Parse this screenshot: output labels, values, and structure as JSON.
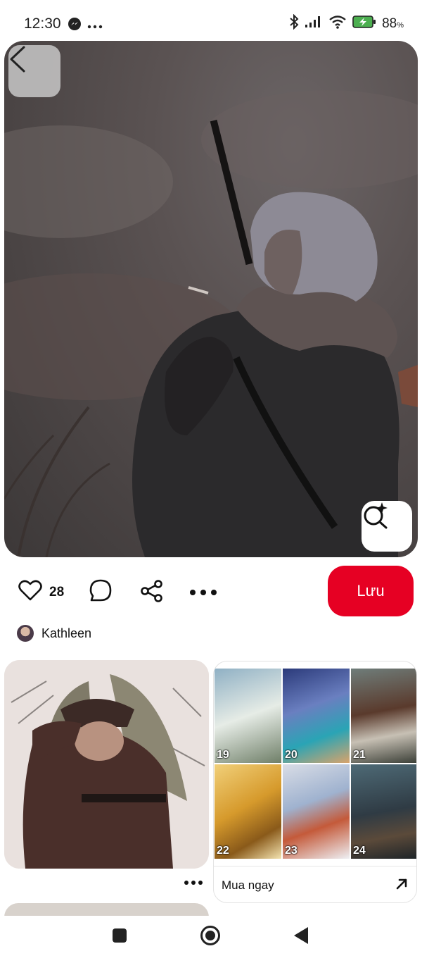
{
  "status_bar": {
    "time": "12:30",
    "battery": "88",
    "battery_unit": "%",
    "icons": [
      "messenger-icon",
      "more-dots-icon",
      "bluetooth-icon",
      "signal-icon",
      "wifi-icon",
      "battery-charging-icon"
    ]
  },
  "pin": {
    "back_icon": "chevron-left-icon",
    "visual_search_icon": "lens-sparkle-icon",
    "like_count": "28",
    "save_label": "Lưu",
    "author_name": "Kathleen"
  },
  "related": {
    "right_card": {
      "tile_numbers": [
        "19",
        "20",
        "21",
        "22",
        "23",
        "24"
      ],
      "buy_label": "Mua ngay",
      "buy_icon": "arrow-up-right-icon"
    }
  },
  "colors": {
    "save_button": "#e60023",
    "hero_tone": "#4a4444"
  }
}
